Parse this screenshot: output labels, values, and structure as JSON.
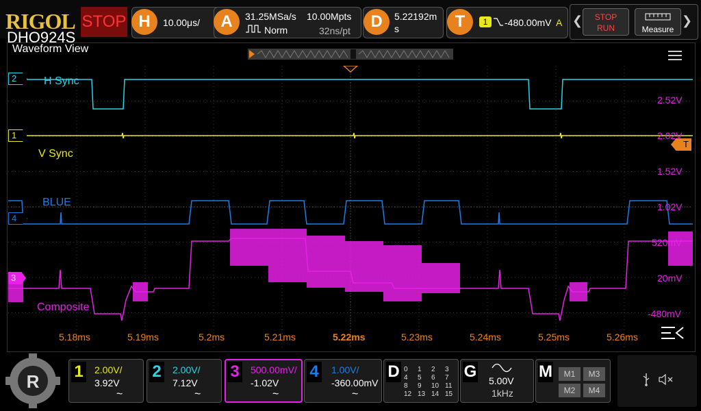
{
  "brand": {
    "logo": "RIGOL",
    "model": "DHO924S"
  },
  "run_state": "STOP",
  "horizontal": {
    "key": "H",
    "timebase": "10.00μs/"
  },
  "acquire": {
    "key": "A",
    "sample_rate": "31.25MSa/s",
    "mode": "Norm",
    "memory": "10.00Mpts",
    "resolution": "32ns/pt"
  },
  "delay": {
    "key": "D",
    "value_line1": "5.22192m",
    "value_line2": "s"
  },
  "trigger": {
    "key": "T",
    "source": "1",
    "level": "-480.00mV",
    "mode": "A"
  },
  "quick_buttons": {
    "stop": "STOP",
    "run": "RUN",
    "measure": "Measure"
  },
  "view_title": "Waveform View",
  "channels_on_screen": {
    "ch2": {
      "marker": "2",
      "name": "H Sync"
    },
    "ch1": {
      "marker": "1",
      "name": "V Sync"
    },
    "ch4": {
      "marker": "4",
      "name": "BLUE"
    },
    "ch3": {
      "marker": "3",
      "name": "Composite"
    }
  },
  "trigger_marker": "T",
  "y_axis_labels": [
    "2.52V",
    "2.02V",
    "1.52V",
    "1.02V",
    "520mV",
    "20mV",
    "-480mV"
  ],
  "x_axis_labels": [
    "5.18ms",
    "5.19ms",
    "5.2ms",
    "5.21ms",
    "5.22ms",
    "5.23ms",
    "5.24ms",
    "5.25ms",
    "5.26ms"
  ],
  "colors": {
    "ch1": "#e8e81a",
    "ch2": "#2ad4e8",
    "ch3": "#e820e8",
    "ch4": "#1a7ee8",
    "accent": "#e8821e"
  },
  "channel_panels": [
    {
      "num": "1",
      "scale": "2.00V/",
      "offset": "3.92V",
      "coupling": "~"
    },
    {
      "num": "2",
      "scale": "2.00V/",
      "offset": "7.12V",
      "coupling": "~"
    },
    {
      "num": "3",
      "scale": "500.00mV/",
      "offset": "-1.02V",
      "coupling": "~"
    },
    {
      "num": "4",
      "scale": "1.00V/",
      "offset": "-360.00mV",
      "coupling": "~"
    }
  ],
  "digital": {
    "key": "D",
    "rows": [
      [
        "0",
        "1",
        "2",
        "3"
      ],
      [
        "4",
        "5",
        "6",
        "7"
      ],
      [
        "8",
        "9",
        "10",
        "11"
      ],
      [
        "12",
        "13",
        "14",
        "15"
      ]
    ]
  },
  "generator": {
    "key": "G",
    "amplitude": "5.00V",
    "frequency": "1kHz"
  },
  "math": {
    "key": "M",
    "slots": [
      "M1",
      "M3",
      "M2",
      "M4"
    ]
  }
}
